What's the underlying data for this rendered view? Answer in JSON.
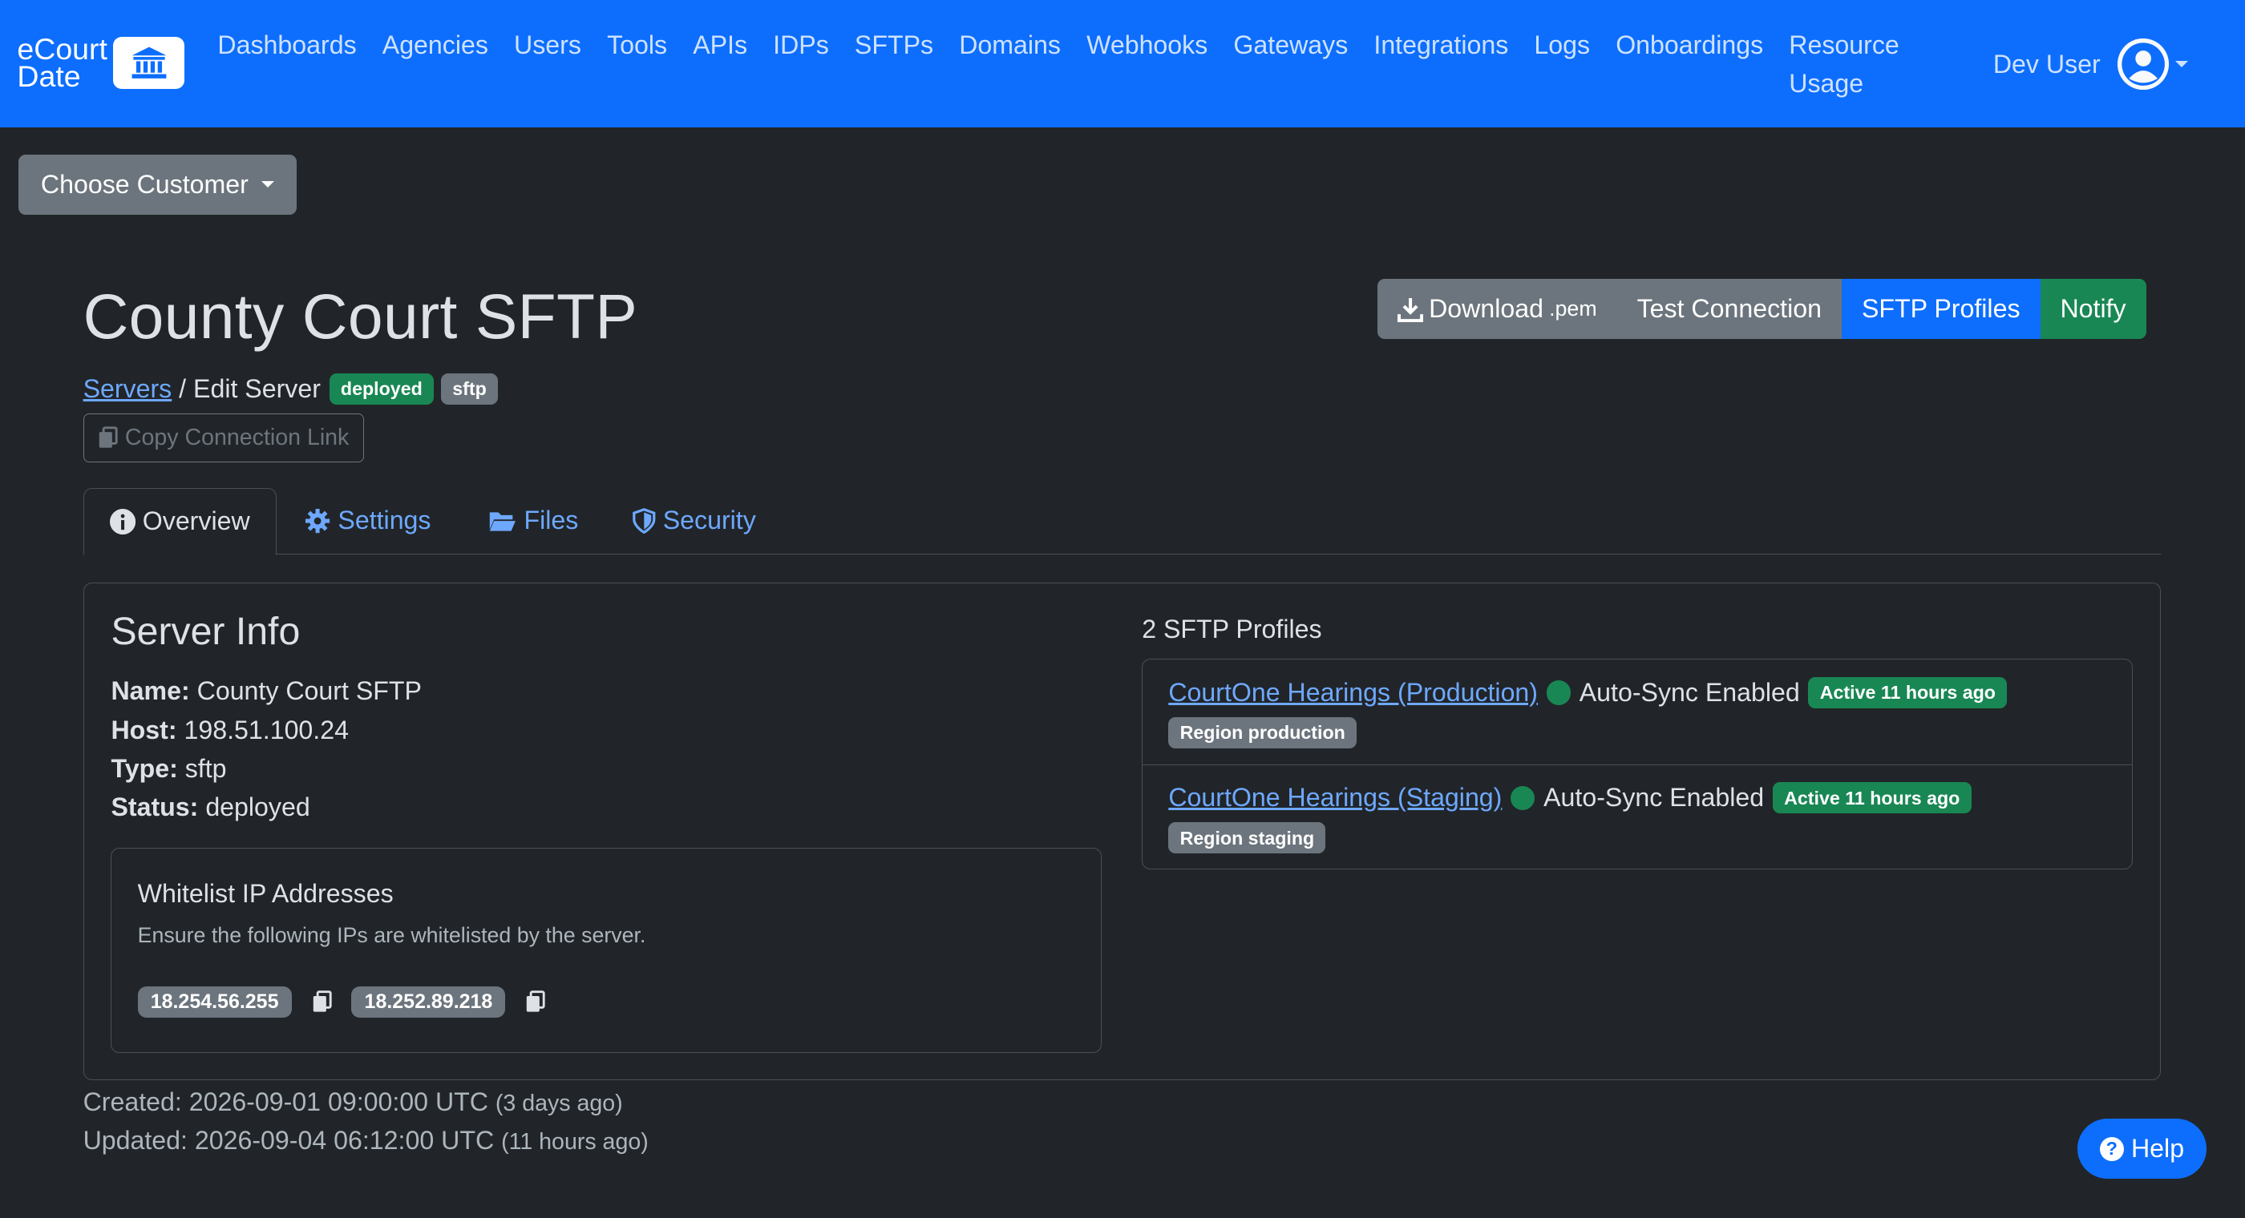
{
  "brand": {
    "line1": "eCourt",
    "line2": "Date"
  },
  "nav": {
    "items": [
      "Dashboards",
      "Agencies",
      "Users",
      "Tools",
      "APIs",
      "IDPs",
      "SFTPs",
      "Domains",
      "Webhooks",
      "Gateways",
      "Integrations",
      "Logs",
      "Onboardings",
      "Resource Usage"
    ],
    "user": "Dev User"
  },
  "customer_button": "Choose Customer",
  "page": {
    "title": "County Court SFTP",
    "breadcrumb_link": "Servers",
    "breadcrumb_rest": "/ Edit Server",
    "badges": [
      "deployed",
      "sftp"
    ],
    "copy_link_label": "Copy Connection Link"
  },
  "actions": {
    "download": "Download",
    "download_ext": ".pem",
    "test": "Test Connection",
    "profiles": "SFTP Profiles",
    "notify": "Notify"
  },
  "tabs": [
    "Overview",
    "Settings",
    "Files",
    "Security"
  ],
  "server_info": {
    "heading": "Server Info",
    "name_label": "Name:",
    "name": "County Court SFTP",
    "host_label": "Host:",
    "host": "198.51.100.24",
    "type_label": "Type:",
    "type": "sftp",
    "status_label": "Status:",
    "status": "deployed"
  },
  "whitelist": {
    "heading": "Whitelist IP Addresses",
    "description": "Ensure the following IPs are whitelisted by the server.",
    "ips": [
      "18.254.56.255",
      "18.252.89.218"
    ]
  },
  "profiles": {
    "heading": "2 SFTP Profiles",
    "items": [
      {
        "name": "CourtOne Hearings (Production)",
        "sync": "Auto-Sync Enabled",
        "active": "Active 11 hours ago",
        "region": "Region production"
      },
      {
        "name": "CourtOne Hearings (Staging)",
        "sync": "Auto-Sync Enabled",
        "active": "Active 11 hours ago",
        "region": "Region staging"
      }
    ]
  },
  "meta": {
    "created_label": "Created:",
    "created": "2026-09-01 09:00:00 UTC",
    "created_rel": "(3 days ago)",
    "updated_label": "Updated:",
    "updated": "2026-09-04 06:12:00 UTC",
    "updated_rel": "(11 hours ago)"
  },
  "help": "Help",
  "colors": {
    "primary": "#0d6efd",
    "success": "#198754",
    "secondary": "#6c757d",
    "background": "#212529"
  }
}
